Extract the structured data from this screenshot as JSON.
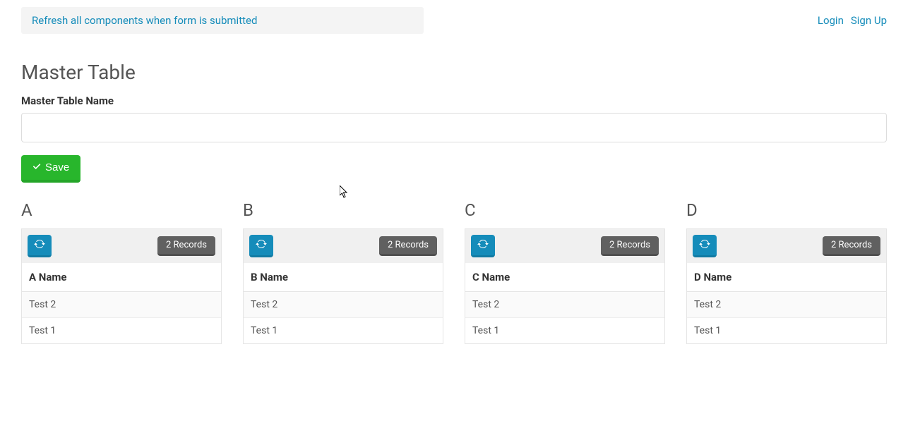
{
  "alert": {
    "text": "Refresh all components when form is submitted"
  },
  "auth": {
    "login": "Login",
    "signup": "Sign Up"
  },
  "page": {
    "title": "Master Table",
    "form": {
      "label": "Master Table Name",
      "value": ""
    },
    "buttons": {
      "save": "Save"
    }
  },
  "sections": [
    {
      "title": "A",
      "records_label": "2 Records",
      "column_header": "A Name",
      "rows": [
        "Test 2",
        "Test 1"
      ]
    },
    {
      "title": "B",
      "records_label": "2 Records",
      "column_header": "B Name",
      "rows": [
        "Test 2",
        "Test 1"
      ]
    },
    {
      "title": "C",
      "records_label": "2 Records",
      "column_header": "C Name",
      "rows": [
        "Test 2",
        "Test 1"
      ]
    },
    {
      "title": "D",
      "records_label": "2 Records",
      "column_header": "D Name",
      "rows": [
        "Test 2",
        "Test 1"
      ]
    }
  ]
}
